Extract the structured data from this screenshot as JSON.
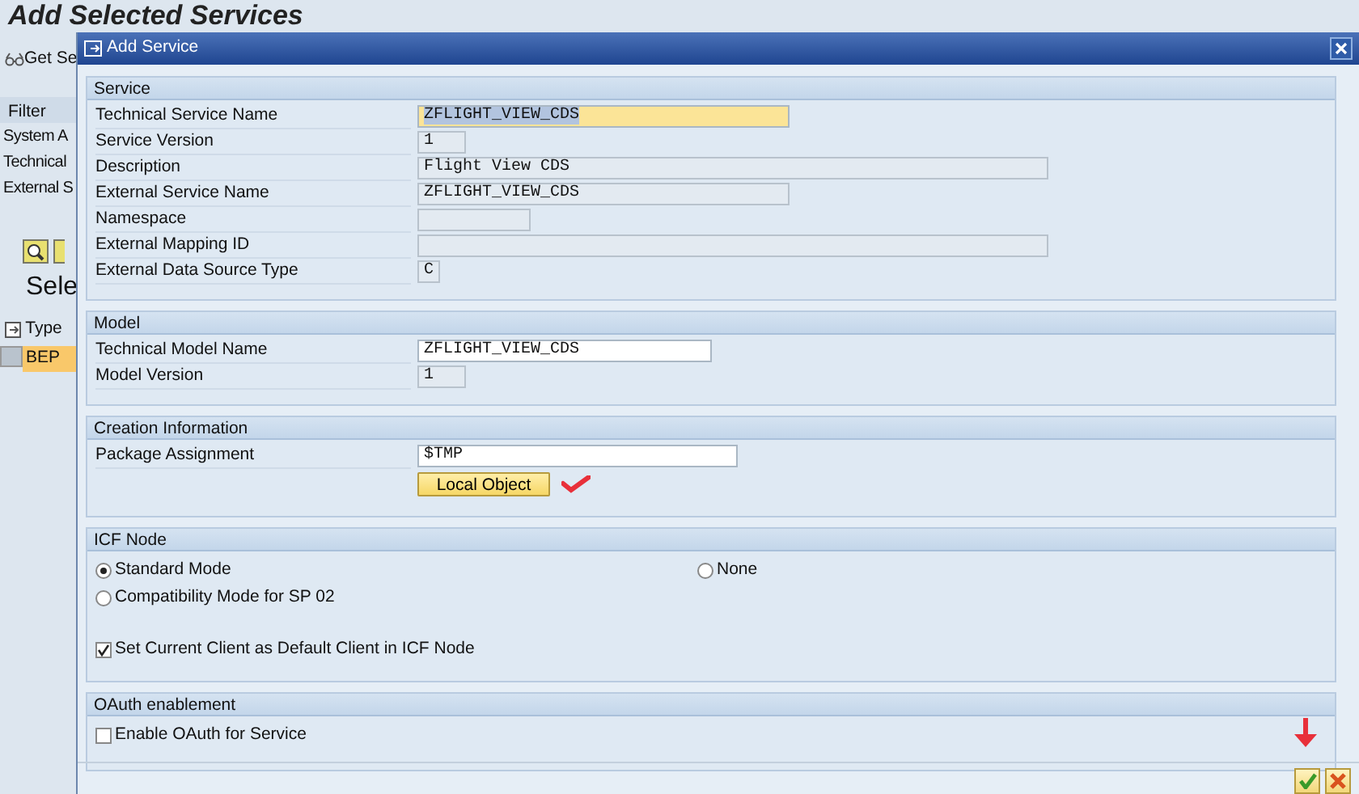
{
  "background": {
    "title": "Add Selected Services",
    "toolbar_button": "Get Se",
    "filter": {
      "header": "Filter",
      "rows": [
        "System A",
        "Technical",
        "External S"
      ]
    },
    "section_title": "Sele",
    "table": {
      "columns": [
        "Type"
      ],
      "rows": [
        {
          "type": "BEP",
          "selected": true
        }
      ]
    }
  },
  "dialog": {
    "title": "Add Service",
    "groups": [
      {
        "title": "Service",
        "fields": [
          {
            "label": "Technical Service Name",
            "value": "ZFLIGHT_VIEW_CDS",
            "editable": true,
            "focused": true
          },
          {
            "label": "Service Version",
            "value": "1",
            "editable": false,
            "focused": false
          },
          {
            "label": "Description",
            "value": "Flight View CDS",
            "editable": false,
            "focused": false
          },
          {
            "label": "External Service Name",
            "value": "ZFLIGHT_VIEW_CDS",
            "editable": false,
            "focused": false
          },
          {
            "label": "Namespace",
            "editable": false,
            "focused": false
          },
          {
            "label": "External Mapping ID",
            "editable": false,
            "focused": false
          },
          {
            "label": "External Data Source Type",
            "value": "C",
            "editable": false,
            "focused": false
          }
        ]
      },
      {
        "title": "Model",
        "fields": [
          {
            "label": "Technical Model Name",
            "value": "ZFLIGHT_VIEW_CDS",
            "editable": true,
            "focused": false
          },
          {
            "label": "Model Version",
            "value": "1",
            "editable": false,
            "focused": false
          }
        ]
      },
      {
        "title": "Creation Information",
        "fields": [
          {
            "label": "Package Assignment",
            "value": "$TMP",
            "editable": true,
            "focused": false
          }
        ],
        "button": "Local Object"
      },
      {
        "title": "ICF Node",
        "options": [
          {
            "kind": "radio",
            "label": "Standard Mode",
            "selected": true
          },
          {
            "kind": "radio",
            "label": "None",
            "selected": false
          },
          {
            "kind": "radio",
            "label": "Compatibility Mode for SP 02",
            "selected": false
          },
          {
            "kind": "checkbox",
            "label": "Set Current Client as Default Client in ICF Node",
            "checked": true
          }
        ]
      },
      {
        "title": "OAuth enablement",
        "options": [
          {
            "kind": "checkbox",
            "label": "Enable OAuth for Service",
            "checked": false
          }
        ]
      }
    ]
  }
}
